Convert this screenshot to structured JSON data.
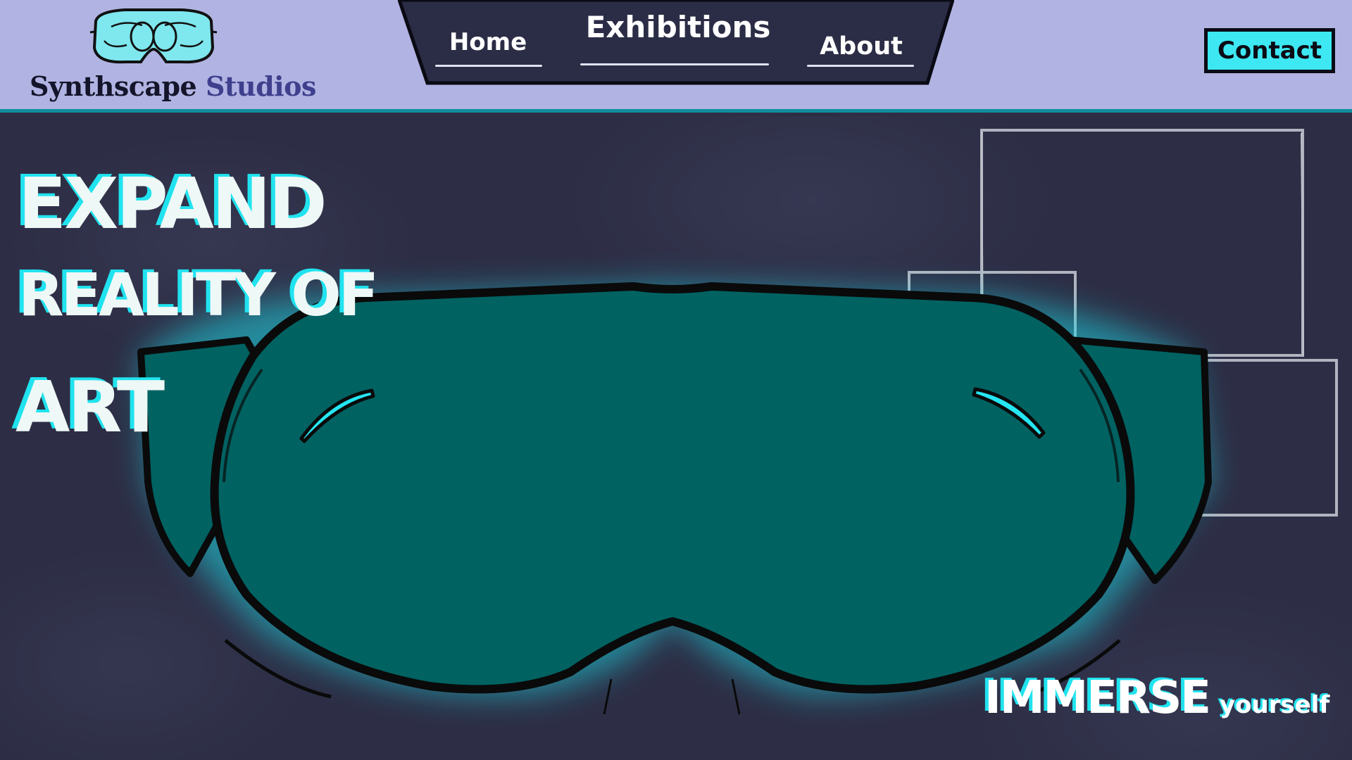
{
  "brand": {
    "name_part1": "Synthscape",
    "name_part2": "Studios",
    "logo_icon": "vr-headset-logo-icon"
  },
  "nav": {
    "items": [
      {
        "label": "Home"
      },
      {
        "label": "Exhibitions"
      },
      {
        "label": "About"
      }
    ]
  },
  "header": {
    "contact_label": "Contact"
  },
  "hero": {
    "headline": [
      "EXPAND",
      "REALITY OF",
      "ART"
    ],
    "tagline_main": "IMMERSE",
    "tagline_sub": "yourself",
    "illustration": "vr-goggles-icon"
  },
  "colors": {
    "header_bg": "#b1b4e2",
    "accent": "#20e3ef",
    "goggle_fill": "#016262",
    "hero_bg": "#2d2e45",
    "nav_tray": "#2b2c45"
  }
}
